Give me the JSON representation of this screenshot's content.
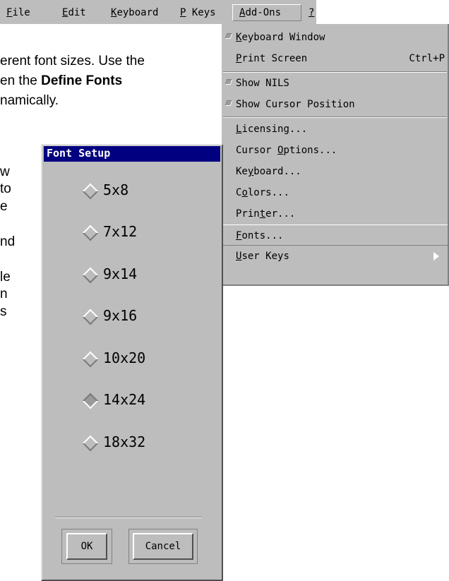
{
  "menubar": {
    "items": [
      {
        "mnemonic": "F",
        "rest": "ile"
      },
      {
        "mnemonic": "E",
        "rest": "dit"
      },
      {
        "mnemonic": "K",
        "rest": "eyboard"
      },
      {
        "mnemonic": "P",
        "rest": " Keys"
      },
      {
        "mnemonic": "A",
        "rest": "dd-Ons"
      },
      {
        "mnemonic": "?",
        "rest": ""
      }
    ]
  },
  "document": {
    "line1": "erent font sizes. Use the",
    "line2_pre": "en the ",
    "line2_bold": "Define Fonts",
    "line3": "namically.",
    "frag1": "w",
    "frag2": "to",
    "frag3": "e",
    "frag4": "nd",
    "frag5": "le",
    "frag6": "n",
    "frag7": "s"
  },
  "dropdown": {
    "items": [
      {
        "pre": "",
        "mn": "K",
        "post": "eyboard Window",
        "checked": true
      },
      {
        "pre": "",
        "mn": "P",
        "post": "rint Screen",
        "accel": "Ctrl+P"
      },
      {
        "pre": "Show NILS",
        "checked": true
      },
      {
        "pre": "Show Cursor Position",
        "checked": true
      },
      {
        "pre": "",
        "mn": "L",
        "post": "icensing..."
      },
      {
        "pre": "Cursor ",
        "mn": "O",
        "post": "ptions..."
      },
      {
        "pre": "Ke",
        "mn": "y",
        "post": "board..."
      },
      {
        "pre": "C",
        "mn": "o",
        "post": "lors..."
      },
      {
        "pre": "Prin",
        "mn": "t",
        "post": "er..."
      },
      {
        "pre": "",
        "mn": "F",
        "post": "onts...",
        "highlighted": true
      },
      {
        "pre": "",
        "mn": "U",
        "post": "ser Keys",
        "submenu": true
      }
    ]
  },
  "dialog": {
    "title": "Font Setup",
    "options": [
      "5x8",
      "7x12",
      "9x14",
      "9x16",
      "10x20",
      "14x24",
      "18x32"
    ],
    "selected_index": 5,
    "ok_label": "OK",
    "cancel_label": "Cancel"
  }
}
